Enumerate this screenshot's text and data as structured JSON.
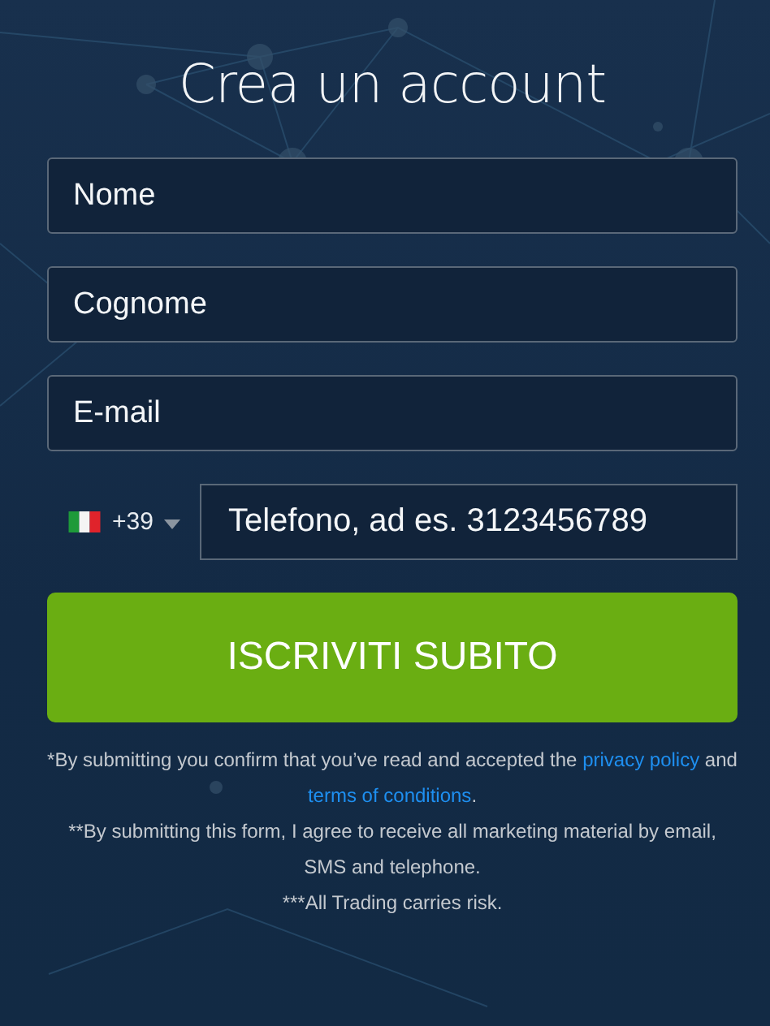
{
  "title": "Crea un account",
  "fields": [
    {
      "placeholder": "Nome"
    },
    {
      "placeholder": "Cognome"
    },
    {
      "placeholder": "E-mail"
    }
  ],
  "phone": {
    "dial_code": "+39",
    "placeholder": "Telefono, ad es. 3123456789"
  },
  "submit": "ISCRIVITI SUBITO",
  "disclaimers": [
    [
      {
        "kind": "text",
        "text": "*By submitting you confirm that you’ve read and accepted the "
      },
      {
        "kind": "link",
        "text": "privacy policy"
      },
      {
        "kind": "text",
        "text": " and "
      },
      {
        "kind": "link",
        "text": "terms of conditions"
      },
      {
        "kind": "text",
        "text": "."
      }
    ],
    [
      {
        "kind": "text",
        "text": "**By submitting this form, I agree to receive all marketing material by email, SMS and telephone."
      }
    ],
    [
      {
        "kind": "text",
        "text": "***All Trading carries risk."
      }
    ]
  ]
}
